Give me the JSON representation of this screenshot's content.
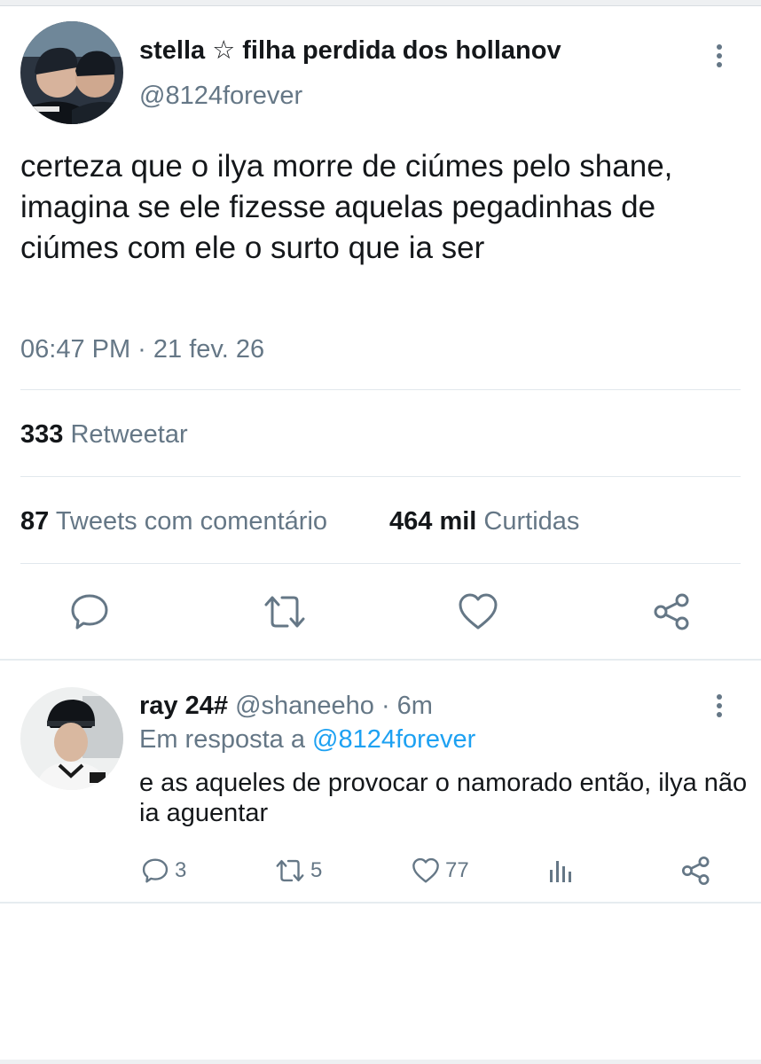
{
  "tweet": {
    "display_name": "stella ☆ filha perdida dos hollanov",
    "handle": "@8124forever",
    "text": "certeza que o ilya morre de ciúmes pelo shane, imagina se ele fizesse aquelas pegadinhas de ciúmes com ele o surto que ia ser",
    "timestamp": "06:47 PM · 21 fev. 26",
    "retweets_count": "333",
    "retweets_label": "Retweetar",
    "quote_count": "87",
    "quote_label": "Tweets com comentário",
    "likes_count": "464 mil",
    "likes_label": "Curtidas",
    "actions": [
      "reply-icon",
      "retweet-icon",
      "like-icon",
      "share-icon"
    ]
  },
  "reply": {
    "display_name": "ray 24#",
    "handle": "@shaneeho",
    "time": "· 6m",
    "reply_prefix": "Em resposta a",
    "reply_to": "@8124forever",
    "text": "e as aqueles de provocar o namorado então, ilya não ia aguentar",
    "reply_count": "3",
    "retweet_count": "5",
    "like_count": "77"
  },
  "colors": {
    "text": "#14171a",
    "muted": "#657786",
    "link": "#1da1f2",
    "separator": "#e1e8ed"
  }
}
